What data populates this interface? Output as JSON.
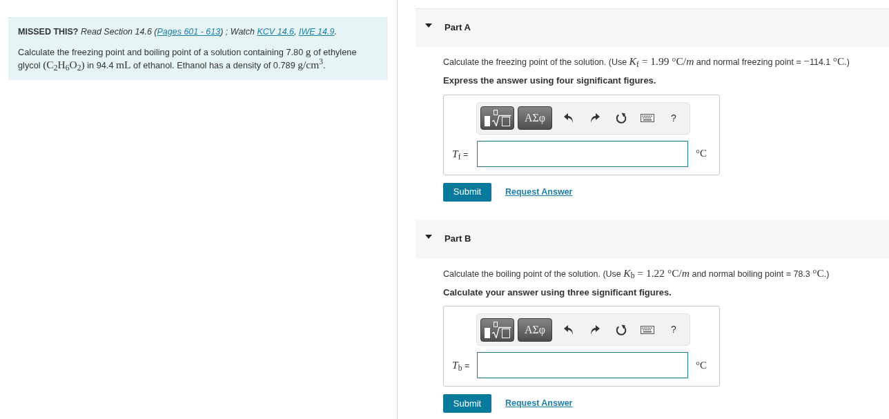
{
  "assignment_note": {
    "segments": [
      {
        "kind": "bold",
        "text": "MISSED THIS?"
      },
      {
        "kind": "text",
        "text": " Read Section 14.6 ("
      },
      {
        "kind": "link",
        "text": "Pages 601 - 613"
      },
      {
        "kind": "text",
        "text": ") ; Watch "
      },
      {
        "kind": "link",
        "text": "KCV 14.6"
      },
      {
        "kind": "text",
        "text": ", "
      },
      {
        "kind": "link",
        "text": "IWE 14.9"
      },
      {
        "kind": "text",
        "text": "."
      }
    ]
  },
  "problem": {
    "segments": [
      {
        "kind": "text",
        "text": "Calculate the freezing point and boiling point of a solution containing 7.80 "
      },
      {
        "kind": "math",
        "text": "g"
      },
      {
        "kind": "text",
        "text": " of ethylene glycol "
      },
      {
        "kind": "math",
        "text": "(C$_{2}$H$_{6}$O$_{2}$)"
      },
      {
        "kind": "text",
        "text": " in 94.4 "
      },
      {
        "kind": "math",
        "text": "mL"
      },
      {
        "kind": "text",
        "text": " of ethanol. Ethanol has a density of 0.789 "
      },
      {
        "kind": "math",
        "text": "g/cm$^{3}$"
      },
      {
        "kind": "text",
        "text": "."
      }
    ]
  },
  "parts": [
    {
      "title": "Part A",
      "expanded": true,
      "prompt": [
        {
          "kind": "text",
          "text": "Calculate the freezing point of the solution. (Use "
        },
        {
          "kind": "math",
          "text": "*K*$_{f}$ = 1.99 °C/*m*"
        },
        {
          "kind": "text",
          "text": " and normal freezing point = "
        },
        {
          "kind": "math",
          "text": "−"
        },
        {
          "kind": "text",
          "text": "114.1 "
        },
        {
          "kind": "math",
          "text": "°C"
        },
        {
          "kind": "text",
          "text": ".)"
        }
      ],
      "instruction": "Express the answer using four significant figures.",
      "toolbar": {
        "symbols_button": "ΑΣφ",
        "help_button": "?"
      },
      "answer": {
        "label": [
          {
            "kind": "math",
            "text": "*T*$_{f}$"
          },
          {
            "kind": "text",
            "text": " ="
          }
        ],
        "unit": "°C"
      },
      "submit": "Submit",
      "request_answer": "Request Answer"
    },
    {
      "title": "Part B",
      "expanded": true,
      "prompt": [
        {
          "kind": "text",
          "text": "Calculate the boiling point of the solution. (Use "
        },
        {
          "kind": "math",
          "text": "*K*$_{b}$ = 1.22 °C/*m*"
        },
        {
          "kind": "text",
          "text": " and normal boiling point = 78.3 "
        },
        {
          "kind": "math",
          "text": "°C"
        },
        {
          "kind": "text",
          "text": ".)"
        }
      ],
      "instruction": "Calculate your answer using three significant figures.",
      "toolbar": {
        "symbols_button": "ΑΣφ",
        "help_button": "?"
      },
      "answer": {
        "label": [
          {
            "kind": "math",
            "text": "*T*$_{b}$"
          },
          {
            "kind": "text",
            "text": " ="
          }
        ],
        "unit": "°C"
      },
      "submit": "Submit",
      "request_answer": "Request Answer"
    }
  ]
}
